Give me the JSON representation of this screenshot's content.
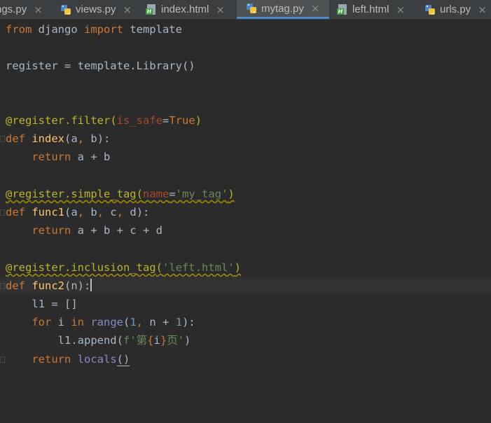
{
  "tabs": [
    {
      "label": "ngs.py",
      "icon": "python-file-icon",
      "active": false
    },
    {
      "label": "views.py",
      "icon": "python-file-icon",
      "active": false
    },
    {
      "label": "index.html",
      "icon": "html-file-icon",
      "active": false
    },
    {
      "label": "mytag.py",
      "icon": "python-file-icon",
      "active": true
    },
    {
      "label": "left.html",
      "icon": "html-file-icon",
      "active": false
    },
    {
      "label": "urls.py",
      "icon": "python-file-icon",
      "active": false
    }
  ],
  "close_glyph": "×",
  "code": {
    "l1": {
      "kw1": "from",
      "t1": " django ",
      "kw2": "import",
      "t2": " template"
    },
    "l3": {
      "t1": "register = template.Library()"
    },
    "l6": {
      "dec1": "@register.filter",
      "p1": "(",
      "param": "is_safe",
      "eq": "=",
      "kw": "True",
      "p2": ")"
    },
    "l7": {
      "kw": "def",
      "sp": " ",
      "fn": "index",
      "args1": "(a",
      "c1": ",",
      "args2": " b):"
    },
    "l8": {
      "ind": "    ",
      "kw": "return",
      "t": " a + b"
    },
    "l10": {
      "dec": "@register.simple_tag",
      "p1": "(",
      "param": "name",
      "eq": "=",
      "str": "'my_tag'",
      "p2": ")"
    },
    "l11": {
      "kw": "def",
      "sp": " ",
      "fn": "func1",
      "a1": "(a",
      "c1": ",",
      "a2": " b",
      "c2": ",",
      "a3": " c",
      "c3": ",",
      "a4": " d):"
    },
    "l12": {
      "ind": "    ",
      "kw": "return",
      "t": " a + b + c + d"
    },
    "l14": {
      "dec": "@register.inclusion_tag",
      "p1": "(",
      "str": "'left.html'",
      "p2": ")"
    },
    "l15": {
      "kw": "def",
      "sp": " ",
      "fn": "func2",
      "t": "(n):"
    },
    "l16": {
      "t": "    l1 = []"
    },
    "l17": {
      "ind": "    ",
      "kw1": "for",
      "t1": " i ",
      "kw2": "in",
      "sp": " ",
      "bi": "range",
      "p1": "(",
      "n1": "1",
      "c1": ",",
      "t2": " n + ",
      "n2": "1",
      "p2": "):"
    },
    "l18": {
      "t1": "        l1.append(",
      "s1": "f'第",
      "kw1": "{",
      "t2": "i",
      "kw2": "}",
      "s2": "页'",
      "p2": ")"
    },
    "l19": {
      "ind": "    ",
      "kw": "return",
      "sp": " ",
      "bi": "locals",
      "p": "()"
    }
  }
}
